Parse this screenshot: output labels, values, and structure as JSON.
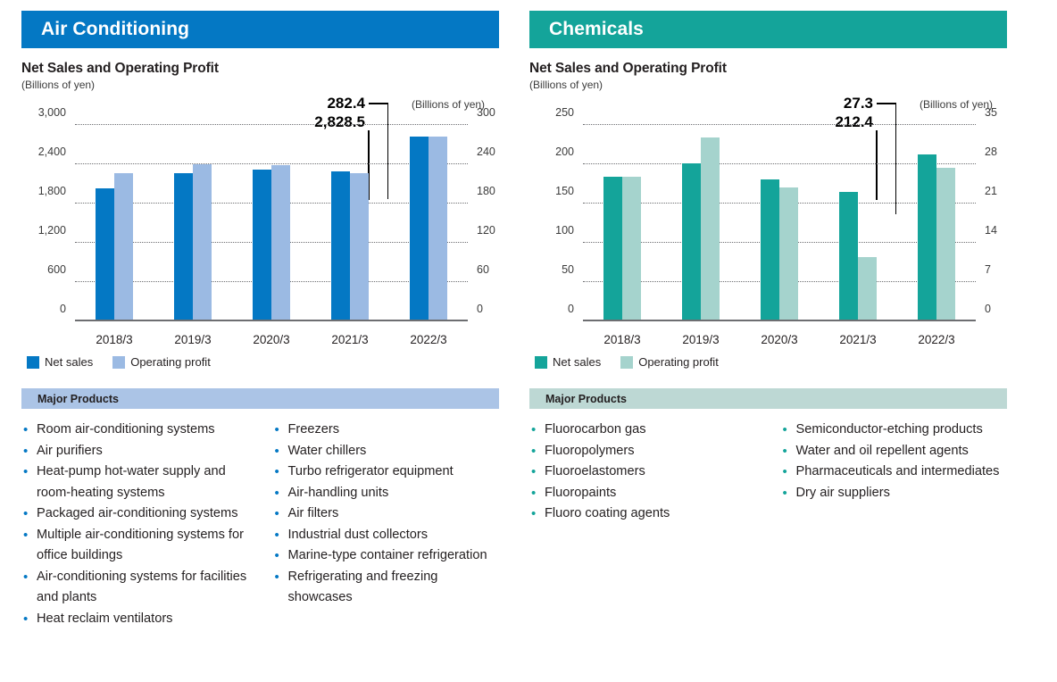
{
  "panels": [
    {
      "id": "air-conditioning",
      "header": "Air Conditioning",
      "accent": "#0478c4",
      "accent_light": "#9bbae3",
      "band": "#abc4e6",
      "chart_title": "Net Sales and Operating Profit",
      "unit_left": "(Billions of yen)",
      "unit_right": "(Billions of yen)",
      "legend": {
        "net_sales": "Net sales",
        "operating_profit": "Operating profit"
      },
      "callout": {
        "operating_profit": "282.4",
        "net_sales": "2,828.5"
      },
      "major_products_label": "Major Products",
      "products_left": [
        "Room air-conditioning systems",
        "Air purifiers",
        "Heat-pump hot-water supply and room-heating systems",
        "Packaged air-conditioning systems",
        "Multiple air-conditioning systems for office buildings",
        "Air-conditioning systems for facilities and plants",
        "Heat reclaim ventilators"
      ],
      "products_right": [
        "Freezers",
        "Water chillers",
        "Turbo refrigerator equipment",
        "Air-handling units",
        "Air filters",
        "Industrial dust collectors",
        "Marine-type container refrigeration",
        "Refrigerating and freezing showcases"
      ]
    },
    {
      "id": "chemicals",
      "header": "Chemicals",
      "accent": "#14a49a",
      "accent_light": "#a5d3cd",
      "band": "#bdd8d4",
      "chart_title": "Net Sales and Operating Profit",
      "unit_left": "(Billions of yen)",
      "unit_right": "(Billions of yen)",
      "legend": {
        "net_sales": "Net sales",
        "operating_profit": "Operating profit"
      },
      "callout": {
        "operating_profit": "27.3",
        "net_sales": "212.4"
      },
      "major_products_label": "Major Products",
      "products_left": [
        "Fluorocarbon gas",
        "Fluoropolymers",
        "Fluoroelastomers",
        "Fluoropaints",
        "Fluoro coating agents"
      ],
      "products_right": [
        "Semiconductor-etching products",
        "Water and oil repellent agents",
        "Pharmaceuticals and intermediates",
        "Dry air suppliers"
      ]
    }
  ],
  "chart_data": [
    {
      "type": "bar",
      "title": "Net Sales and Operating Profit",
      "subtitle": "Air Conditioning",
      "categories": [
        "2018/3",
        "2019/3",
        "2020/3",
        "2021/3",
        "2022/3"
      ],
      "series": [
        {
          "name": "Net sales",
          "values": [
            2030,
            2265,
            2315,
            2290,
            2828.5
          ],
          "axis": "left",
          "color": "#0478c4"
        },
        {
          "name": "Operating profit",
          "values": [
            227,
            240,
            238,
            226,
            282.4
          ],
          "axis": "right",
          "color": "#9bbae3"
        }
      ],
      "left_axis": {
        "label": "(Billions of yen)",
        "ticks": [
          "0",
          "600",
          "1,200",
          "1,800",
          "2,400",
          "3,000"
        ],
        "min": 0,
        "max": 3000
      },
      "right_axis": {
        "label": "(Billions of yen)",
        "ticks": [
          "0",
          "60",
          "120",
          "180",
          "240",
          "300"
        ],
        "min": 0,
        "max": 300
      },
      "annotations": [
        "282.4",
        "2,828.5"
      ],
      "grid": true,
      "legend_position": "bottom-left"
    },
    {
      "type": "bar",
      "title": "Net Sales and Operating Profit",
      "subtitle": "Chemicals",
      "categories": [
        "2018/3",
        "2019/3",
        "2020/3",
        "2021/3",
        "2022/3"
      ],
      "series": [
        {
          "name": "Net sales",
          "values": [
            184,
            201,
            181,
            165,
            212.4
          ],
          "axis": "left",
          "color": "#14a49a"
        },
        {
          "name": "Operating profit",
          "values": [
            25.7,
            32.7,
            23.9,
            11.5,
            27.3
          ],
          "axis": "right",
          "color": "#a5d3cd"
        }
      ],
      "left_axis": {
        "label": "(Billions of yen)",
        "ticks": [
          "0",
          "50",
          "100",
          "150",
          "200",
          "250"
        ],
        "min": 0,
        "max": 250
      },
      "right_axis": {
        "label": "(Billions of yen)",
        "ticks": [
          "0",
          "7",
          "14",
          "21",
          "28",
          "35"
        ],
        "min": 0,
        "max": 35
      },
      "annotations": [
        "27.3",
        "212.4"
      ],
      "grid": true,
      "legend_position": "bottom-left"
    }
  ]
}
